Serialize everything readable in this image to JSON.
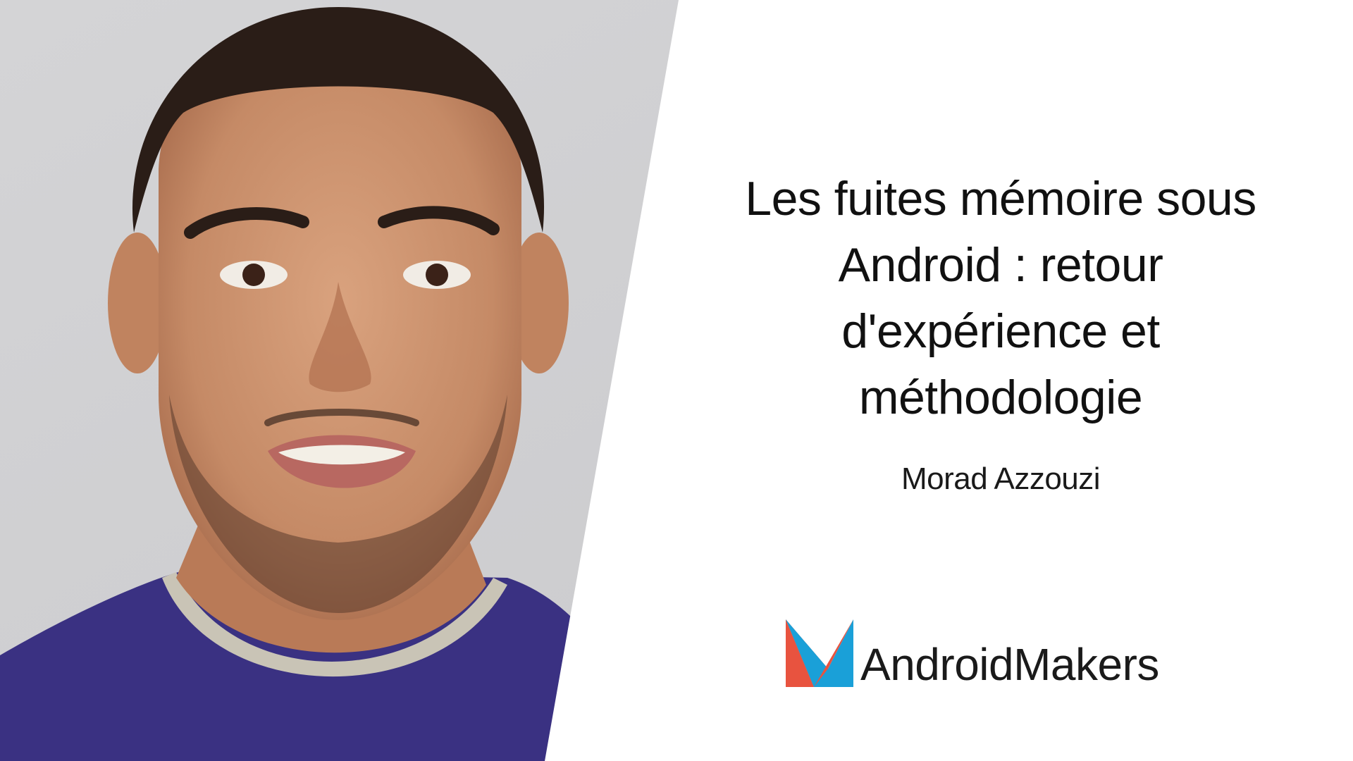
{
  "slide": {
    "title_lines": [
      "Les fuites mémoire sous",
      "Android : retour",
      "d'expérience et",
      "méthodologie"
    ],
    "speaker_name": "Morad Azzouzi",
    "logo": {
      "text": "AndroidMakers",
      "icon": "android-makers-logo-icon"
    },
    "photo": {
      "icon": "speaker-portrait"
    },
    "colors": {
      "background": "#ffffff",
      "photo_backdrop": "#d7d7d9",
      "shirt": "#3a3182",
      "logo_red": "#e8533f",
      "logo_blue": "#1aa0d8",
      "text": "#111111"
    }
  }
}
